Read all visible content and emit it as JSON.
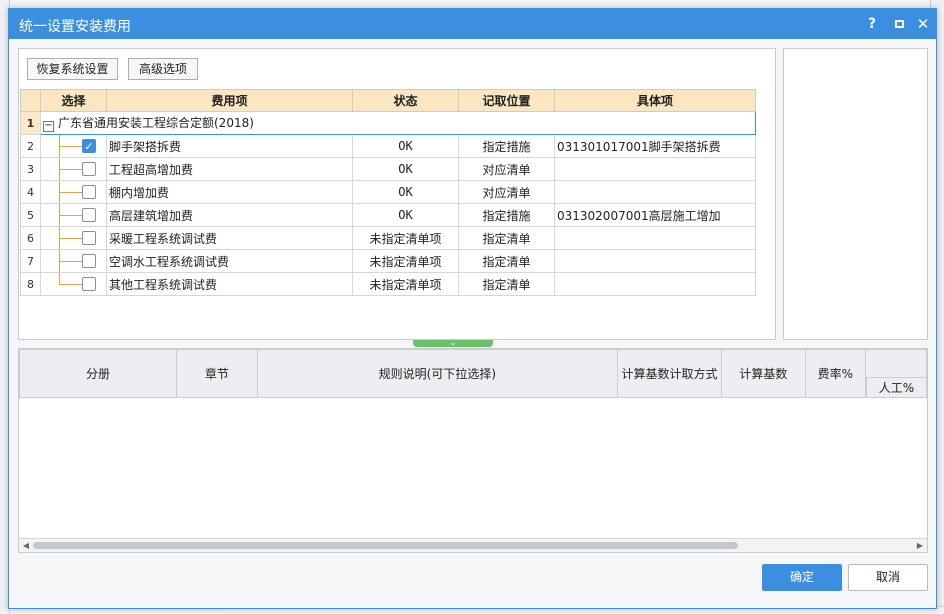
{
  "dialog": {
    "title": "统一设置安装费用",
    "help_glyph": "?",
    "close_glyph": "✕"
  },
  "toolbar": {
    "restore_label": "恢复系统设置",
    "advanced_label": "高级选项"
  },
  "fee_table": {
    "headers": {
      "select": "选择",
      "fee_item": "费用项",
      "status": "状态",
      "record_location": "记取位置",
      "specific_item": "具体项"
    },
    "group": {
      "row_num": "1",
      "label": "广东省通用安装工程综合定额(2018)",
      "expander": "−"
    },
    "rows": [
      {
        "row_num": "2",
        "checked": true,
        "fee_item": "脚手架搭拆费",
        "status": "OK",
        "record_location": "指定措施",
        "specific_item": "031301017001脚手架搭拆费"
      },
      {
        "row_num": "3",
        "checked": false,
        "fee_item": "工程超高增加费",
        "status": "OK",
        "record_location": "对应清单",
        "specific_item": ""
      },
      {
        "row_num": "4",
        "checked": false,
        "fee_item": "棚内增加费",
        "status": "OK",
        "record_location": "对应清单",
        "specific_item": ""
      },
      {
        "row_num": "5",
        "checked": false,
        "fee_item": "高层建筑增加费",
        "status": "OK",
        "record_location": "指定措施",
        "specific_item": "031302007001高层施工增加"
      },
      {
        "row_num": "6",
        "checked": false,
        "fee_item": "采暖工程系统调试费",
        "status": "未指定清单项",
        "record_location": "指定清单",
        "specific_item": ""
      },
      {
        "row_num": "7",
        "checked": false,
        "fee_item": "空调水工程系统调试费",
        "status": "未指定清单项",
        "record_location": "指定清单",
        "specific_item": ""
      },
      {
        "row_num": "8",
        "checked": false,
        "fee_item": "其他工程系统调试费",
        "status": "未指定清单项",
        "record_location": "指定清单",
        "specific_item": ""
      }
    ]
  },
  "rules_table": {
    "headers": {
      "volume": "分册",
      "chapter": "章节",
      "rule_desc": "规则说明(可下拉选择)",
      "calc_method": "计算基数计取方式",
      "calc_base": "计算基数",
      "rate": "费率%",
      "labor": "人工%"
    }
  },
  "footer": {
    "ok_label": "确定",
    "cancel_label": "取消"
  },
  "colors": {
    "accent": "#3c8fe0",
    "header_bg": "#fbe6c2",
    "splitter": "#6cc06a",
    "tree_line": "#e8a24a"
  }
}
